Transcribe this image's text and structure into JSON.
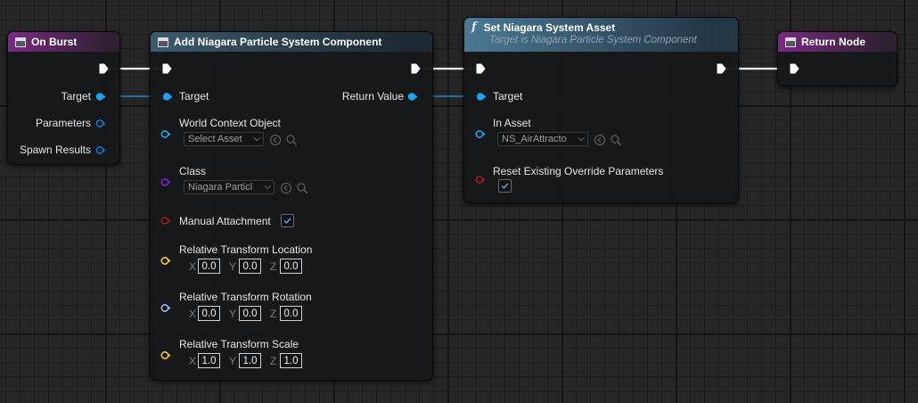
{
  "colors": {
    "exec": "#ffffff",
    "object": "#1aa3f0",
    "structure": "#0c72d6",
    "class": "#7a23c9",
    "bool": "#9a1f1f",
    "vector": "#f5c52a",
    "rotator": "#a0aef5",
    "event_header": "#7a2a82",
    "function_header": "#4b7894"
  },
  "on_burst": {
    "title": "On Burst",
    "pins": {
      "target": "Target",
      "parameters": "Parameters",
      "spawn_results": "Spawn Results"
    }
  },
  "add_component": {
    "title": "Add Niagara Particle System Component",
    "pins": {
      "target": "Target",
      "world_context": "World Context Object",
      "world_context_value": "Select Asset",
      "class": "Class",
      "class_value": "Niagara Particl",
      "manual_attachment": "Manual Attachment",
      "manual_attachment_checked": true,
      "location": "Relative Transform Location",
      "rotation": "Relative Transform Rotation",
      "scale": "Relative Transform Scale",
      "return_value": "Return Value"
    },
    "location_values": {
      "x": "0.0",
      "y": "0.0",
      "z": "0.0"
    },
    "rotation_values": {
      "x": "0.0",
      "y": "0.0",
      "z": "0.0"
    },
    "scale_values": {
      "x": "1.0",
      "y": "1.0",
      "z": "1.0"
    },
    "axes": {
      "x": "X",
      "y": "Y",
      "z": "Z"
    }
  },
  "set_asset": {
    "glyph": "f",
    "title": "Set Niagara System Asset",
    "subtitle": "Target is Niagara Particle System Component",
    "pins": {
      "target": "Target",
      "in_asset": "In Asset",
      "in_asset_value": "NS_AirAttracto",
      "reset": "Reset Existing Override Parameters",
      "reset_checked": true
    }
  },
  "return_node": {
    "title": "Return Node"
  },
  "icons": {
    "dropdown": "chevron-down-icon",
    "browse": "arrow-left-circle-icon",
    "search": "magnifier-icon",
    "check": "checkmark-icon"
  }
}
